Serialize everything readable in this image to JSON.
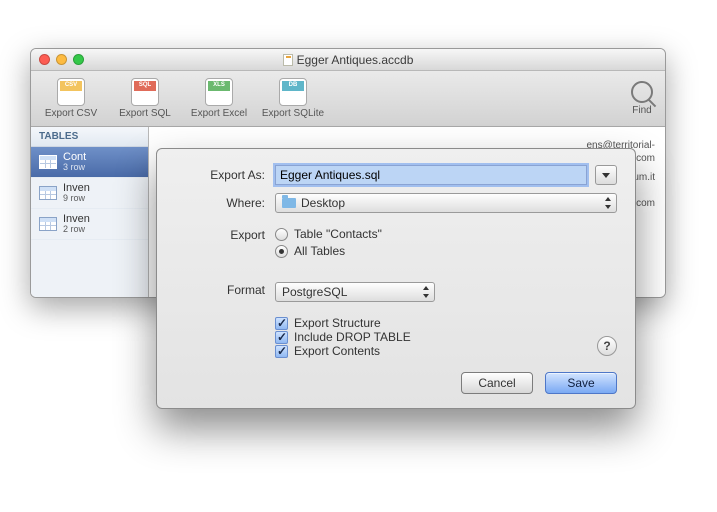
{
  "window": {
    "title": "Egger Antiques.accdb"
  },
  "toolbar": {
    "items": [
      {
        "label": "Export CSV",
        "tag": "CSV"
      },
      {
        "label": "Export SQL",
        "tag": "SQL"
      },
      {
        "label": "Export Excel",
        "tag": "XLS"
      },
      {
        "label": "Export SQLite",
        "tag": "DB"
      }
    ],
    "findLabel": "Find"
  },
  "sidebar": {
    "header": "TABLES",
    "items": [
      {
        "name": "Cont",
        "rows": "3 row"
      },
      {
        "name": "Inven",
        "rows": "9 row"
      },
      {
        "name": "Inven",
        "rows": "2 row"
      }
    ]
  },
  "dataPeek": {
    "emails": [
      "ens@territorial-",
      "se.com",
      "@imperium.it",
      "acebook.com"
    ]
  },
  "dialog": {
    "exportAsLabel": "Export As:",
    "filename": "Egger Antiques.sql",
    "whereLabel": "Where:",
    "whereValue": "Desktop",
    "exportLabel": "Export",
    "radioTable": "Table \"Contacts\"",
    "radioAll": "All Tables",
    "formatLabel": "Format",
    "formatValue": "PostgreSQL",
    "checkStructure": "Export Structure",
    "checkDrop": "Include DROP TABLE",
    "checkContents": "Export Contents",
    "help": "?",
    "cancel": "Cancel",
    "save": "Save"
  }
}
